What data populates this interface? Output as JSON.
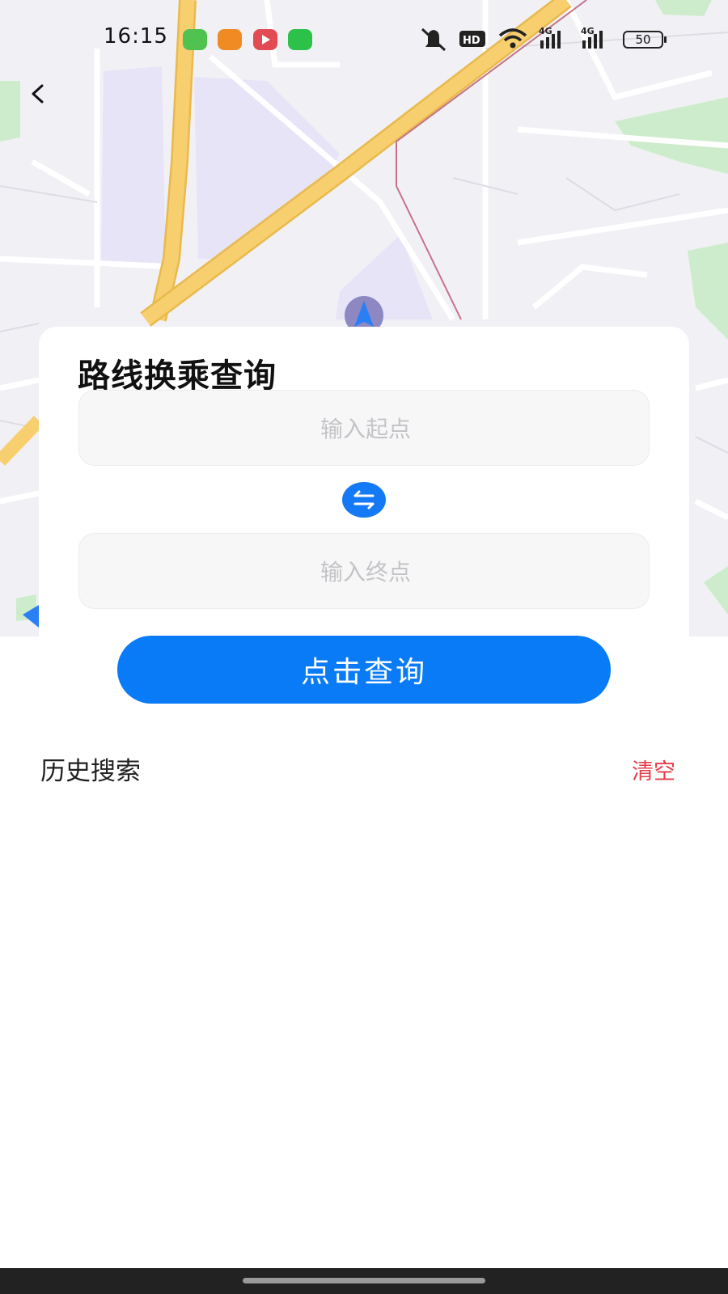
{
  "status_bar": {
    "time": "16:15",
    "battery": "50",
    "network_labels": [
      "4G",
      "4G"
    ],
    "hd_label": "HD"
  },
  "header": {
    "back_icon": "chevron-left-icon"
  },
  "card": {
    "title": "路线换乘查询",
    "start_placeholder": "输入起点",
    "end_placeholder": "输入终点",
    "swap_icon": "swap-arrows-icon"
  },
  "query_button": "点击查询",
  "history": {
    "title": "历史搜索",
    "clear": "清空"
  },
  "colors": {
    "accent": "#0a7bf7",
    "clear_red": "#e43d4a",
    "road_yellow": "#f7cf6e",
    "park_green": "#c9ecc9",
    "block_purple": "#e8e6f7"
  }
}
